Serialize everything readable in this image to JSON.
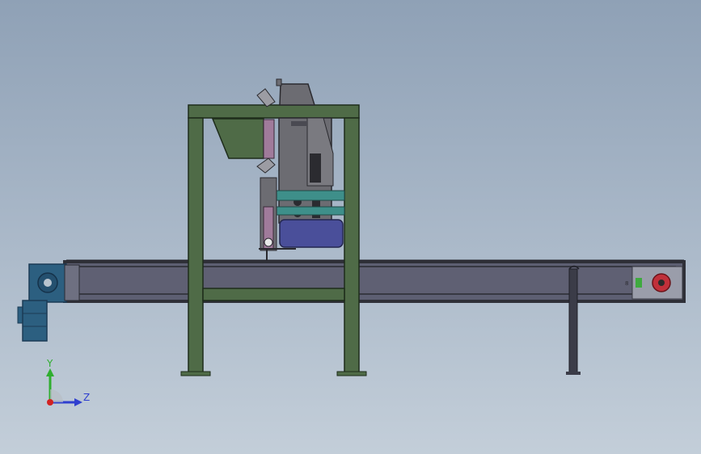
{
  "viewport": {
    "background_top": "#8fa1b6",
    "background_bottom": "#c3ced9"
  },
  "model": {
    "frame_color": "#4f6b47",
    "conveyor_color": "#5d5f72",
    "motor_color": "#2c5f80",
    "head_color": "#6c6c72",
    "blue_drive_color": "#4a4f9a",
    "red_sprocket_color": "#c0303a",
    "green_part_color": "#3faa3f",
    "small_label": "8"
  },
  "triad": {
    "y_label": "Y",
    "z_label": "Z",
    "y_color": "#2fae2f",
    "z_color": "#2f3fcf",
    "origin_color": "#d22222"
  }
}
